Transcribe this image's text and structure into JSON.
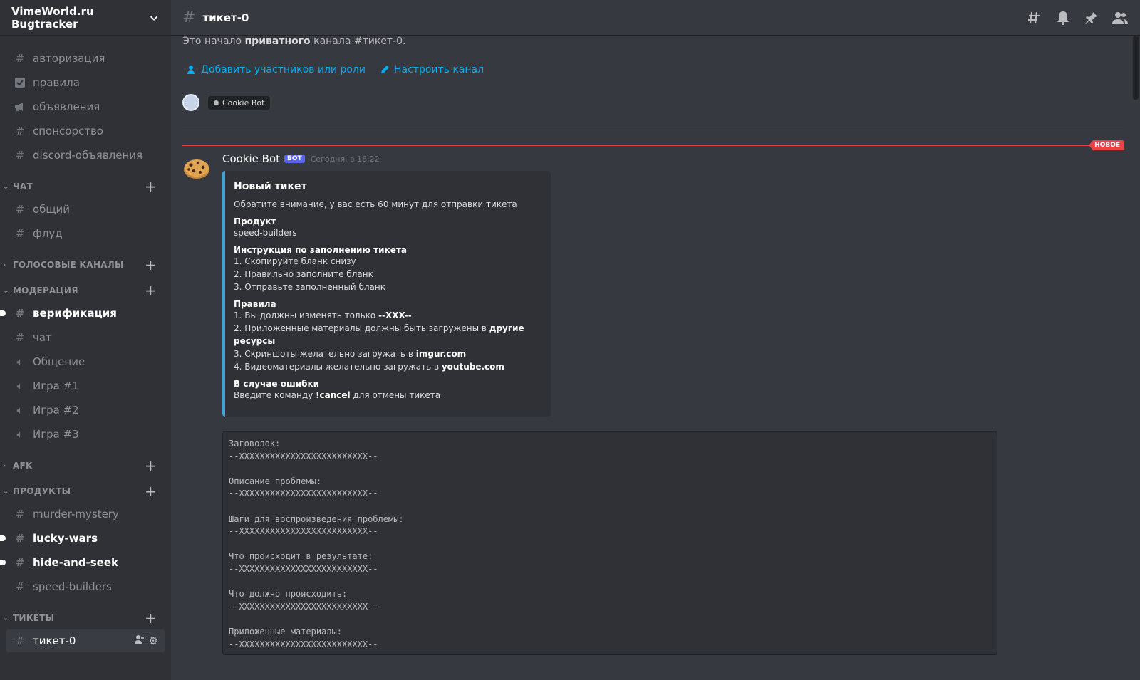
{
  "server": {
    "name": "VimeWorld.ru Bugtracker"
  },
  "sidebar": {
    "top_channels": [
      {
        "label": "авторизация",
        "icon": "hash-icon"
      },
      {
        "label": "правила",
        "icon": "checkbox-icon"
      },
      {
        "label": "объявления",
        "icon": "megaphone-icon"
      },
      {
        "label": "спонсорство",
        "icon": "hash-icon"
      },
      {
        "label": "discord-объявления",
        "icon": "hash-icon"
      }
    ],
    "categories": {
      "chat": {
        "label": "ЧАТ",
        "channels": [
          "общий",
          "флуд"
        ]
      },
      "voice": {
        "label": "ГОЛОСОВЫЕ КАНАЛЫ"
      },
      "moderation": {
        "label": "МОДЕРАЦИЯ",
        "channels": [
          "верификация",
          "чат",
          "Общение",
          "Игра #1",
          "Игра #2",
          "Игра #3"
        ]
      },
      "afk": {
        "label": "AFK"
      },
      "products": {
        "label": "ПРОДУКТЫ",
        "channels": [
          "murder-mystery",
          "lucky-wars",
          "hide-and-seek",
          "speed-builders"
        ]
      },
      "tickets": {
        "label": "ТИКЕТЫ",
        "channels": [
          "тикет-0"
        ]
      }
    }
  },
  "topbar": {
    "channel": "тикет-0"
  },
  "intro": {
    "prefix": "Это начало ",
    "bold": "приватного",
    "suffix": " канала #тикет-0.",
    "add_members": "Добавить участников или роли",
    "configure": "Настроить канал",
    "member_chip": "Cookie Bot"
  },
  "new_badge": "НОВОЕ",
  "message": {
    "author": "Cookie Bot",
    "bot_tag": "БОТ",
    "time": "Сегодня, в 16:22",
    "embed": {
      "title": "Новый тикет",
      "description": "Обратите внимание, у вас есть 60 минут для отправки тикета",
      "product_name": "Продукт",
      "product_value": "speed-builders",
      "instructions_name": "Инструкция по заполнению тикета",
      "instructions": [
        "1. Скопируйте бланк снизу",
        "2. Правильно заполните бланк",
        "3. Отправьте заполненный бланк"
      ],
      "rules_name": "Правила",
      "rule1_text": "1. Вы должны изменять только ",
      "rule1_bold": "--XXX--",
      "rule2_text": "2. Приложенные материалы должны быть загружены в ",
      "rule2_bold": "другие ресурсы",
      "rule3_text": "3. Скриншоты желательно загружать в ",
      "rule3_bold": "imgur.com",
      "rule4_text": "4. Видеоматериалы желательно загружать в ",
      "rule4_bold": "youtube.com",
      "error_name": "В случае ошибки",
      "error_pre": "Введите команду ",
      "error_bold": "!cancel",
      "error_post": " для отмены тикета"
    },
    "code": "Заговолок:\n--XXXXXXXXXXXXXXXXXXXXXXXXX--\n\nОписание проблемы:\n--XXXXXXXXXXXXXXXXXXXXXXXXX--\n\nШаги для воспроизведения проблемы:\n--XXXXXXXXXXXXXXXXXXXXXXXXX--\n\nЧто происходит в результате:\n--XXXXXXXXXXXXXXXXXXXXXXXXX--\n\nЧто должно происходить:\n--XXXXXXXXXXXXXXXXXXXXXXXXX--\n\nПриложенные материалы:\n--XXXXXXXXXXXXXXXXXXXXXXXXX--"
  },
  "colors": {
    "accent": "#5865f2",
    "link": "#00aff4",
    "new_line": "#ed4245",
    "embed_border": "#3ba6d8"
  }
}
